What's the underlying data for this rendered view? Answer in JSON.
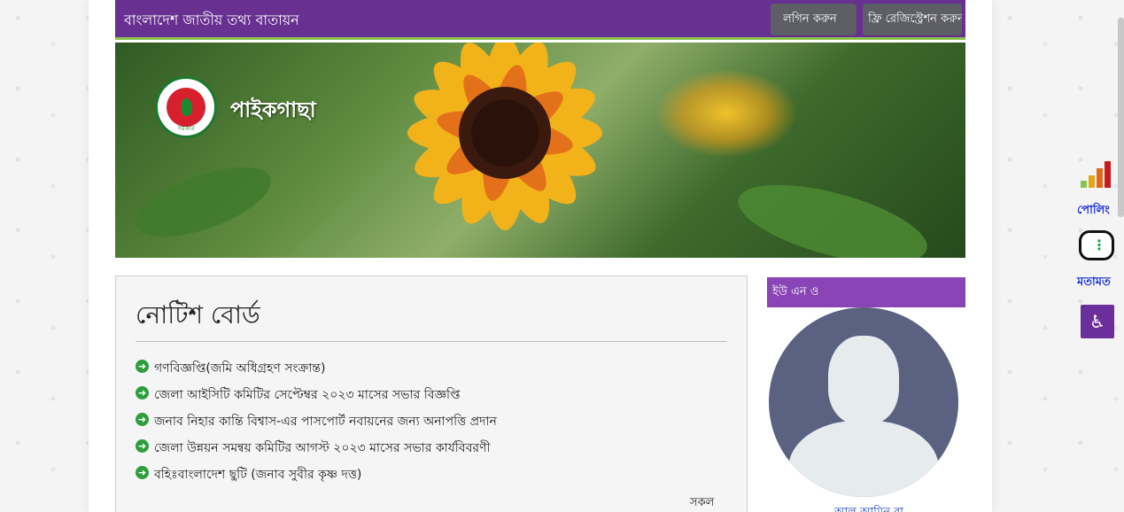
{
  "header": {
    "site_title": "বাংলাদেশ জাতীয় তথ্য বাতায়ন",
    "login_label": "লগিন করুন",
    "register_label": "ফ্রি রেজিস্ট্রেশন করুন"
  },
  "banner": {
    "place_name": "পাইকগাছা",
    "emblem_text": "সরকার"
  },
  "notice_board": {
    "title": "নোটিশ বোর্ড",
    "items": [
      "গণবিজ্ঞপ্তি(জমি অধিগ্রহণ সংক্রান্ত)",
      "জেলা আইসিটি কমিটির সেপ্টেম্বর ২০২৩ মাসের সভার বিজ্ঞপ্তি",
      "জনাব নিহার কান্তি বিশ্বাস-এর পাসপোর্ট নবায়নের জন্য অনাপত্তি প্রদান",
      "জেলা উন্নয়ন সমন্বয় কমিটির আগস্ট ২০২৩ মাসের সভার কার্যবিবরণী",
      "বহিঃবাংলাদেশ ছুটি (জনাব সুবীর কৃষ্ণ দত্ত)"
    ],
    "all_label": "সকল"
  },
  "sidebar": {
    "heading": "ইউ এন ও",
    "officer_name": "আল আমিন রা"
  },
  "right_tools": {
    "poll_label": "পোলিং",
    "feedback_label": "মতামত",
    "accessibility_symbol": "♿"
  },
  "colors": {
    "header_purple": "#683091",
    "accent_green": "#8bc34a",
    "sidebar_heading": "#8a44b6",
    "link_blue": "#1a3fbf"
  }
}
